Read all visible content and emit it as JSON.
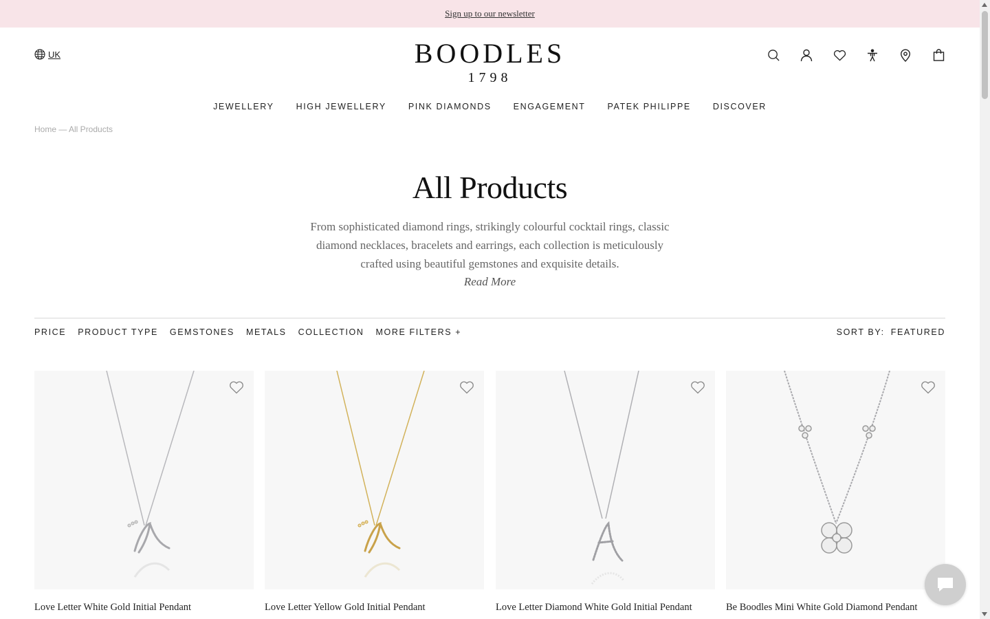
{
  "banner": {
    "newsletter_link": "Sign up to our newsletter"
  },
  "header": {
    "locale": "UK",
    "brand": "BOODLES",
    "year": "1798",
    "icons": [
      "search-icon",
      "account-icon",
      "wishlist-icon",
      "accessibility-icon",
      "store-locator-icon",
      "bag-icon"
    ]
  },
  "nav": {
    "items": [
      "JEWELLERY",
      "HIGH JEWELLERY",
      "PINK DIAMONDS",
      "ENGAGEMENT",
      "PATEK PHILIPPE",
      "DISCOVER"
    ]
  },
  "breadcrumb": "Home — All Products",
  "page": {
    "title": "All Products",
    "description": "From sophisticated diamond rings, strikingly colourful cocktail rings, classic diamond necklaces, bracelets and earrings, each collection is meticulously crafted using beautiful gemstones and exquisite details.",
    "read_more": "Read More"
  },
  "filters": {
    "items": [
      "PRICE",
      "PRODUCT TYPE",
      "GEMSTONES",
      "METALS",
      "COLLECTION",
      "MORE FILTERS +"
    ],
    "sort_label": "SORT BY:",
    "sort_value": "FEATURED"
  },
  "products": [
    {
      "name": "Love Letter White Gold Initial Pendant",
      "metal_color": "#b8b8bc"
    },
    {
      "name": "Love Letter Yellow Gold Initial Pendant",
      "metal_color": "#d2b25a"
    },
    {
      "name": "Love Letter Diamond White Gold Initial Pendant",
      "metal_color": "#b0b0b4"
    },
    {
      "name": "Be Boodles Mini White Gold Diamond Pendant",
      "metal_color": "#a9a9ad"
    }
  ],
  "colors": {
    "banner_bg": "#f8e4e8",
    "text": "#1a1a1a",
    "muted": "#aaaaaa"
  }
}
